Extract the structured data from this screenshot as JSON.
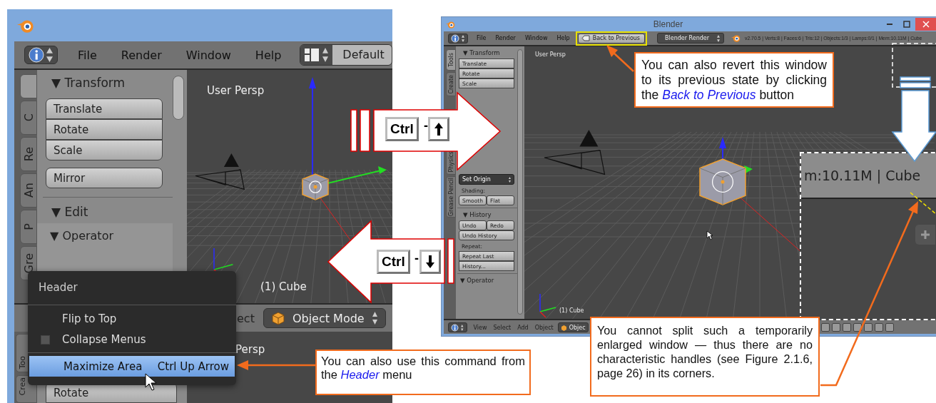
{
  "left_window": {
    "header_menu": [
      "File",
      "Render",
      "Window",
      "Help"
    ],
    "screen_layout": "Default",
    "side_tabs": [
      {
        "selected": true
      },
      {
        "label": "C",
        "selected": false
      },
      {
        "label": "Re",
        "selected": false
      },
      {
        "label": "An",
        "selected": false
      },
      {
        "label": "P",
        "selected": false
      },
      {
        "label": "Gre",
        "selected": false
      }
    ],
    "transform_panel": {
      "title": "▼ Transform",
      "buttons": [
        "Translate",
        "Rotate",
        "Scale"
      ],
      "extra_button": "Mirror"
    },
    "next_panel": "▼ Edit",
    "operator_panel": "▼ Operator",
    "viewport": {
      "view_label": "User Persp",
      "object_label": "(1) Cube"
    },
    "bottom_header": {
      "menu_fragment": "ect",
      "mode": "Object Mode"
    },
    "lower_area": {
      "side_tabs": [
        "Too",
        "Crea"
      ],
      "button": "Rotate",
      "view_label": "Persp"
    },
    "context_menu": {
      "title": "Header",
      "items": [
        {
          "kind": "action",
          "label": "Flip to Top",
          "selected": false
        },
        {
          "kind": "checkbox",
          "label": "Collapse Menus",
          "checked": false,
          "selected": false
        },
        {
          "kind": "action",
          "label": "Maximize Area",
          "shortcut": "Ctrl Up Arrow",
          "selected": true
        }
      ]
    }
  },
  "shortcuts": [
    {
      "kind": "up",
      "key": "Ctrl",
      "separator": "-"
    },
    {
      "kind": "down",
      "key": "Ctrl",
      "separator": "-"
    }
  ],
  "right_window": {
    "title": "Blender",
    "header_menu": [
      "File",
      "Render",
      "Window",
      "Help"
    ],
    "back_button": {
      "label": "Back to Previous",
      "highlighted": true
    },
    "render_engine": "Blender Render",
    "stats": "v2.70.5 | Verts:8 | Faces:6 | Tris:12 | Objects:1/3 | Lamps:0/1 | Mem:10.11M | Cube",
    "side_tabs": [
      {
        "label": "Tools",
        "selected": true
      },
      {
        "label": "Create",
        "selected": false
      },
      {
        "label": "Physics",
        "selected": false
      },
      {
        "label": "Grease Pencil",
        "selected": false
      }
    ],
    "transform_panel": {
      "title": "▼ Transform",
      "buttons": [
        "Translate",
        "Rotate",
        "Scale"
      ]
    },
    "set_origin": "Set Origin",
    "shading_label": "Shading:",
    "shading_buttons": [
      "Smooth",
      "Flat"
    ],
    "history_panel": {
      "title": "▼ History",
      "row_buttons": [
        "Undo",
        "Redo"
      ],
      "button": "Undo History",
      "repeat_label": "Repeat:",
      "repeat_buttons": [
        "Repeat Last",
        "History..."
      ]
    },
    "operator_panel": "▼ Operator",
    "viewport": {
      "view_label": "User Persp",
      "object_label": "(1) Cube"
    },
    "bottom_header": {
      "menu": [
        "View",
        "Select",
        "Add",
        "Object"
      ],
      "mode": "Objec"
    },
    "zoom_inset": {
      "text": "m:10.11M | Cube"
    }
  },
  "callouts": [
    {
      "text": "You can also revert this window to its previous state by clicking the *Back to Previous* button"
    },
    {
      "text": "You can also use this command from the *Header* menu"
    },
    {
      "text": "You cannot split such a temporarily enlarged window — thus there are no characteristic handles (see Figure 2.1.6, page 26) in its corners."
    }
  ]
}
